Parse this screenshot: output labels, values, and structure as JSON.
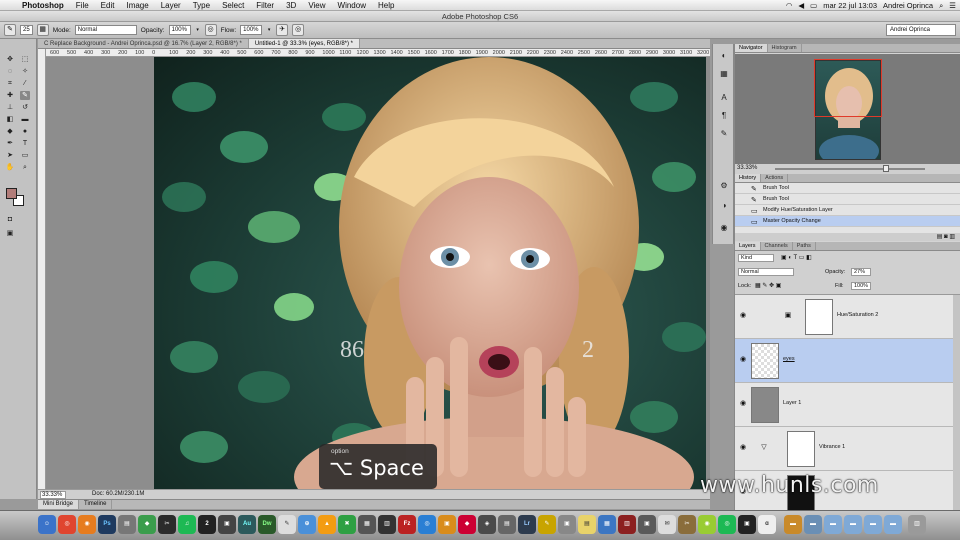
{
  "menubar": {
    "app": "Photoshop",
    "menus": [
      "File",
      "Edit",
      "Image",
      "Layer",
      "Type",
      "Select",
      "Filter",
      "3D",
      "View",
      "Window",
      "Help"
    ],
    "clock": "mar 22 jul  13:03",
    "user": "Andrei Oprinca"
  },
  "window": {
    "title": "Adobe Photoshop CS6"
  },
  "options": {
    "brush_size": "25",
    "mode_label": "Mode:",
    "mode_value": "Normal",
    "opacity_label": "Opacity:",
    "opacity_value": "100%",
    "flow_label": "Flow:",
    "flow_value": "100%",
    "workspace": "Andrei Oprinca"
  },
  "doc_tabs": [
    "C Replace Background - Andrei Oprinca.psd @ 16.7% (Layer 2, RGB/8*) *",
    "Untitled-1 @ 33.3% (eyes, RGB/8*) *"
  ],
  "ruler_ticks": [
    "600",
    "500",
    "400",
    "300",
    "200",
    "100",
    "0",
    "100",
    "200",
    "300",
    "400",
    "500",
    "600",
    "700",
    "800",
    "900",
    "1000",
    "1100",
    "1200",
    "1300",
    "1400",
    "1500",
    "1600",
    "1700",
    "1800",
    "1900",
    "2000",
    "2100",
    "2200",
    "2300",
    "2400",
    "2500",
    "2600",
    "2700",
    "2800",
    "2900",
    "3000",
    "3100",
    "3200"
  ],
  "canvas": {
    "left_number": "86",
    "right_number": "2"
  },
  "key_overlay": {
    "modifier": "option",
    "keys": "⌥ Space"
  },
  "status": {
    "zoom": "33.33%",
    "doc": "Doc: 60.2M/230.1M"
  },
  "bottom_tabs": [
    "Mini Bridge",
    "Timeline"
  ],
  "navigator": {
    "tabs": [
      "Navigator",
      "Histogram"
    ],
    "zoom": "33.33%"
  },
  "history": {
    "tabs": [
      "History",
      "Actions"
    ],
    "items": [
      "Brush Tool",
      "Brush Tool",
      "Modify Hue/Saturation Layer",
      "Master Opacity Change"
    ]
  },
  "layers": {
    "tabs": [
      "Layers",
      "Channels",
      "Paths"
    ],
    "kind": "Kind",
    "blend_mode": "Normal",
    "opacity_label": "Opacity:",
    "opacity_value": "27%",
    "lock_label": "Lock:",
    "fill_label": "Fill:",
    "fill_value": "100%",
    "rows": [
      "Hue/Saturation 2",
      "eyes",
      "Layer 1",
      "Vibrance 1"
    ]
  },
  "watermark": "www.hunls.com",
  "dock_labels": [
    "Ps",
    "2",
    "Au",
    "Dw",
    "Lr",
    "Fz"
  ],
  "colors": {
    "foreground_swatch": "#b27d7a",
    "selection_highlight": "#b9cdf0",
    "navigator_frame": "#e03a2a"
  }
}
